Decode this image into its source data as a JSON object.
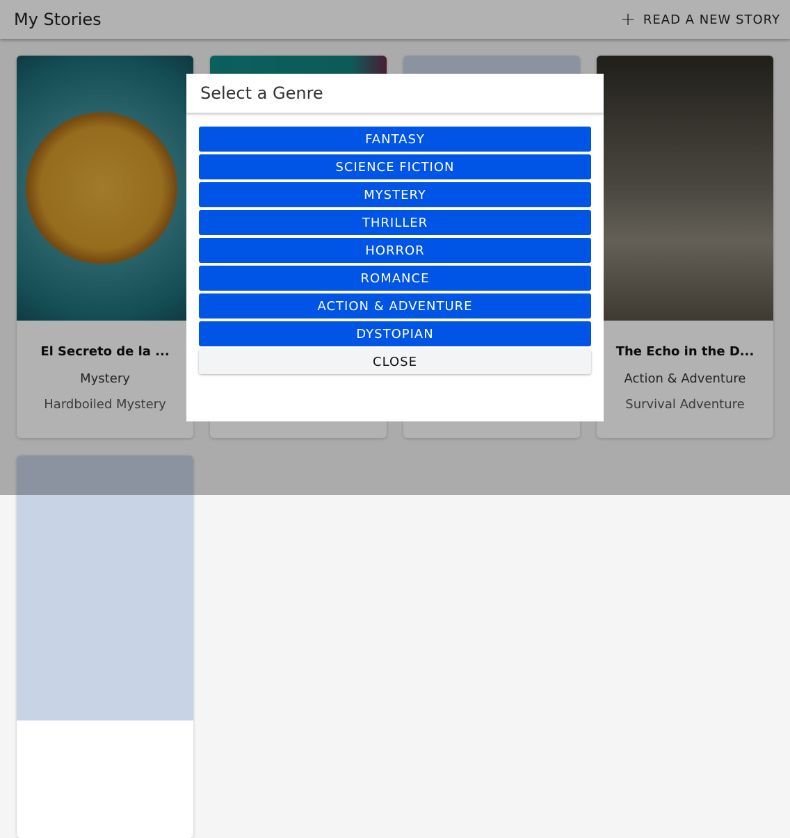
{
  "header": {
    "title": "My Stories",
    "new_story_label": "READ A NEW STORY",
    "new_story_icon": "plus-icon"
  },
  "stories": [
    {
      "title": "El Secreto de la ...",
      "genre": "Mystery",
      "subgenre": "Hardboiled Mystery"
    },
    {
      "title": "The Echo in the D...",
      "genre": "Action & Adventure",
      "subgenre": "Survival Adventure"
    }
  ],
  "modal": {
    "title": "Select a Genre",
    "genres": [
      "FANTASY",
      "SCIENCE FICTION",
      "MYSTERY",
      "THRILLER",
      "HORROR",
      "ROMANCE",
      "ACTION & ADVENTURE",
      "DYSTOPIAN"
    ],
    "close_label": "CLOSE"
  },
  "colors": {
    "primary": "#0055e6"
  }
}
